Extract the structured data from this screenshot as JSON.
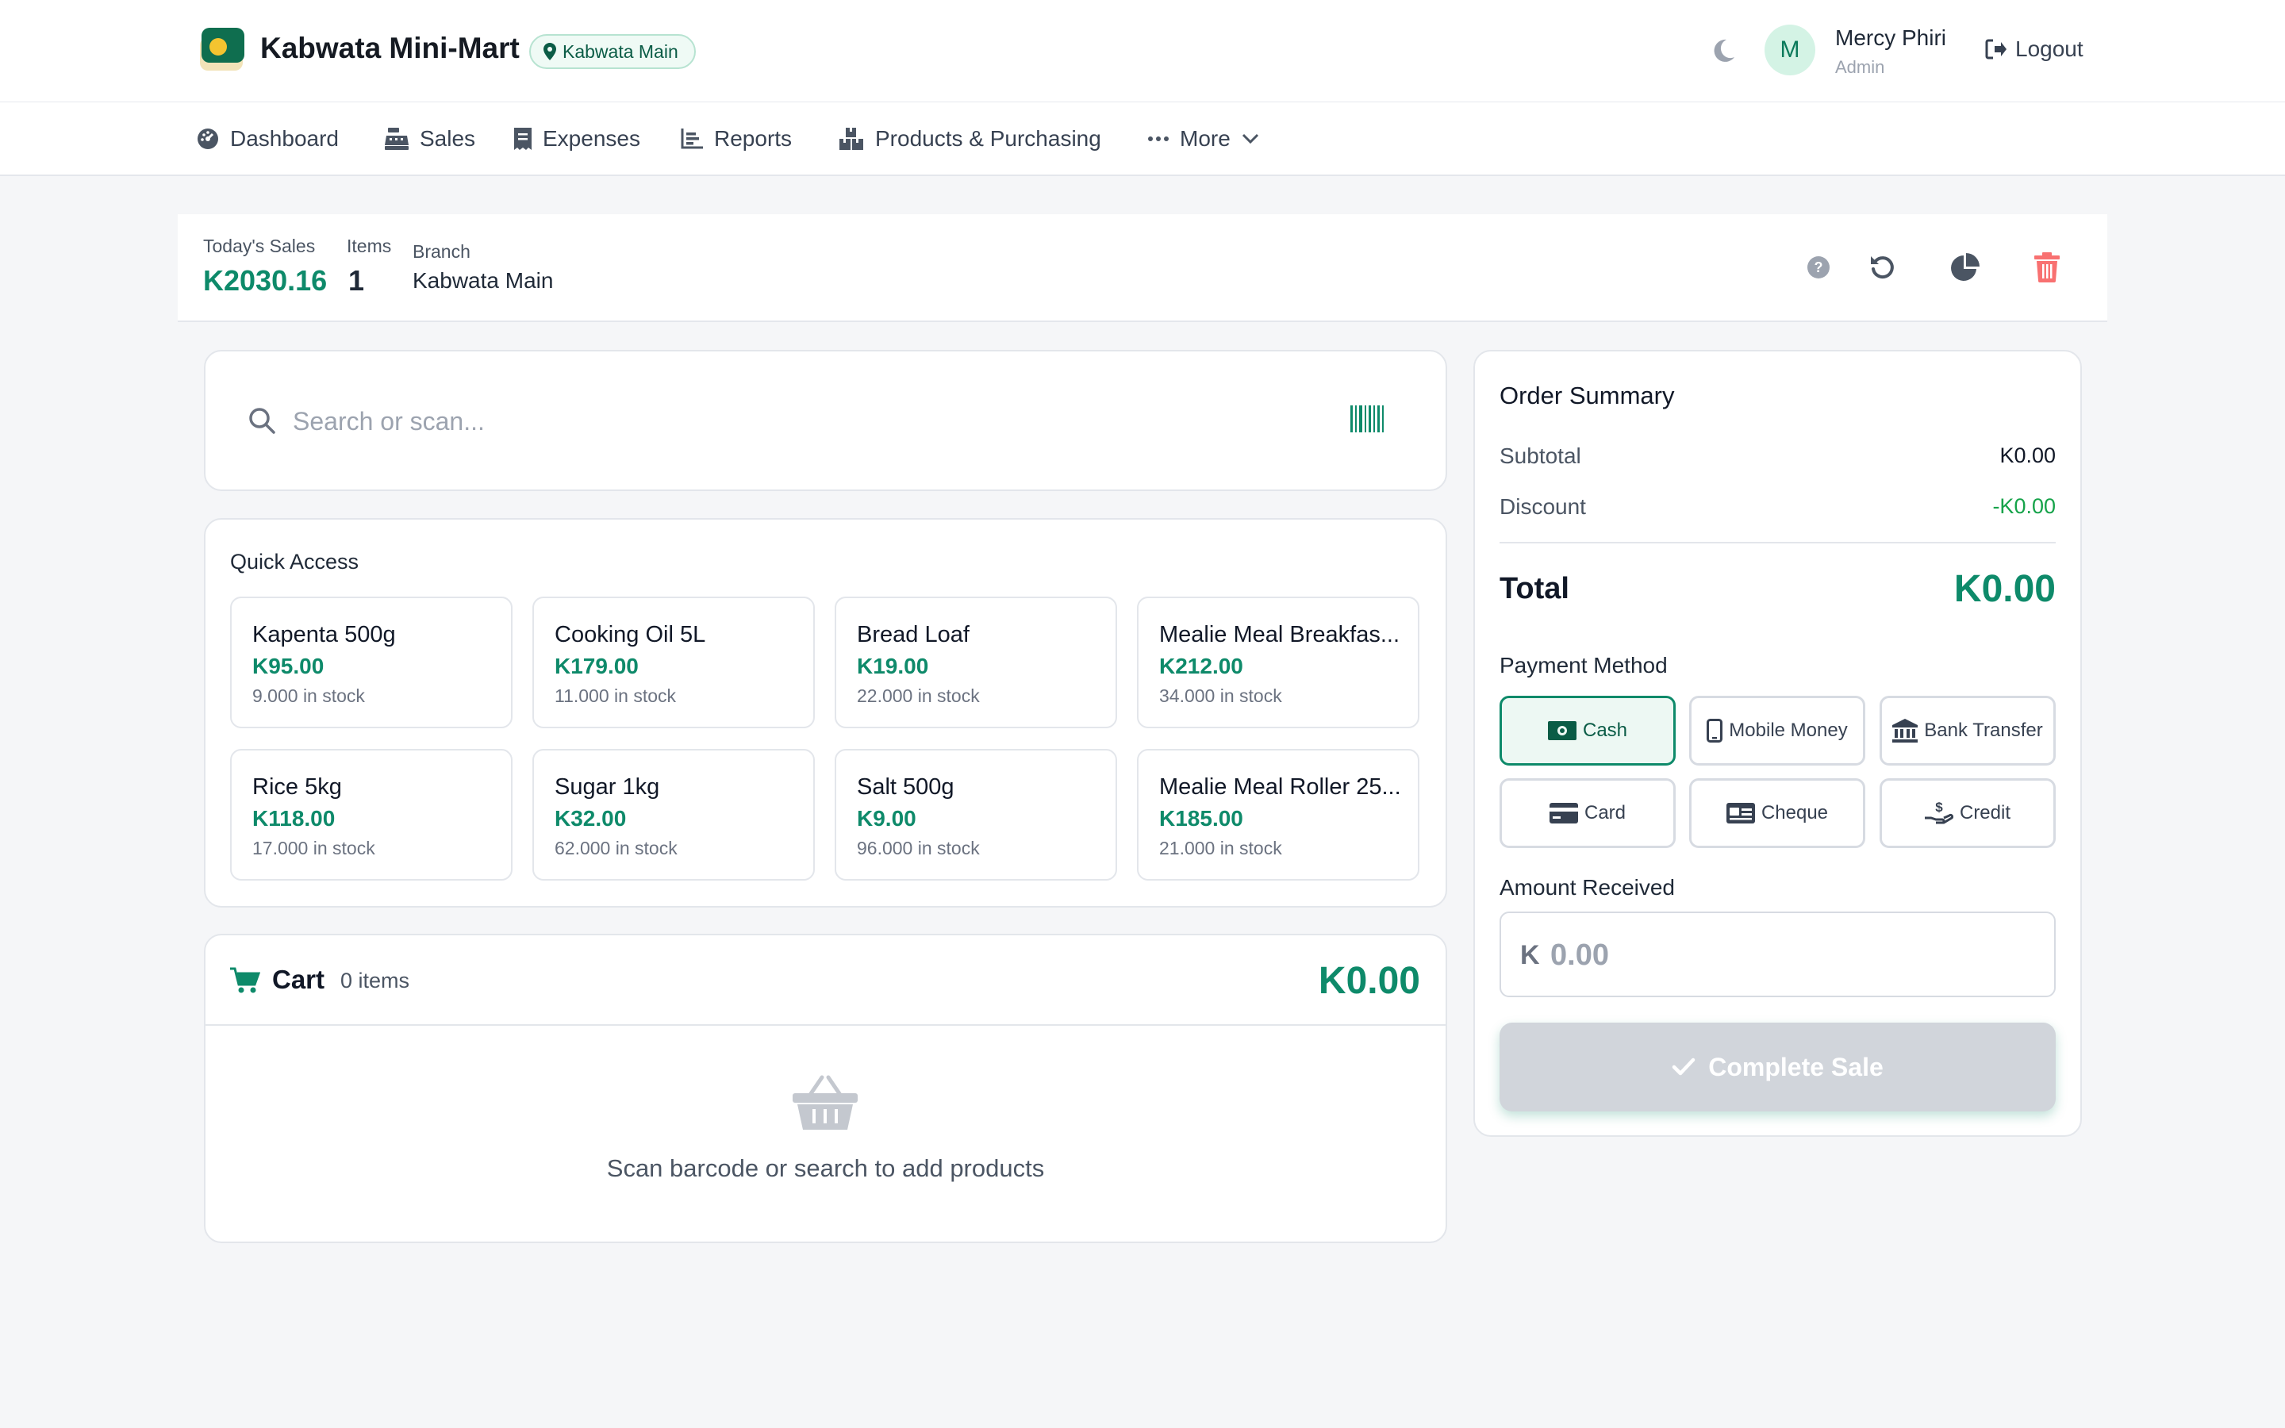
{
  "header": {
    "brand": "Kabwata Mini-Mart",
    "branch_badge": "Kabwata Main",
    "user_initial": "M",
    "user_name": "Mercy Phiri",
    "user_role": "Admin",
    "logout_label": "Logout"
  },
  "nav": {
    "items": [
      {
        "label": "Dashboard",
        "icon": "gauge-icon"
      },
      {
        "label": "Sales",
        "icon": "cash-register-icon"
      },
      {
        "label": "Expenses",
        "icon": "receipt-icon"
      },
      {
        "label": "Reports",
        "icon": "bar-chart-icon"
      },
      {
        "label": "Products & Purchasing",
        "icon": "boxes-icon"
      },
      {
        "label": "More",
        "icon": "ellipsis-icon"
      }
    ]
  },
  "stats": {
    "todays_sales_label": "Today's Sales",
    "todays_sales_value": "K2030.16",
    "items_label": "Items",
    "items_value": "1",
    "branch_label": "Branch",
    "branch_value": "Kabwata Main"
  },
  "search": {
    "placeholder": "Search or scan..."
  },
  "quick_access": {
    "title": "Quick Access",
    "products": [
      {
        "name": "Kapenta 500g",
        "price": "K95.00",
        "stock": "9.000 in stock"
      },
      {
        "name": "Cooking Oil 5L",
        "price": "K179.00",
        "stock": "11.000 in stock"
      },
      {
        "name": "Bread Loaf",
        "price": "K19.00",
        "stock": "22.000 in stock"
      },
      {
        "name": "Mealie Meal Breakfas...",
        "price": "K212.00",
        "stock": "34.000 in stock"
      },
      {
        "name": "Rice 5kg",
        "price": "K118.00",
        "stock": "17.000 in stock"
      },
      {
        "name": "Sugar 1kg",
        "price": "K32.00",
        "stock": "62.000 in stock"
      },
      {
        "name": "Salt 500g",
        "price": "K9.00",
        "stock": "96.000 in stock"
      },
      {
        "name": "Mealie Meal Roller 25...",
        "price": "K185.00",
        "stock": "21.000 in stock"
      }
    ]
  },
  "cart": {
    "title": "Cart",
    "count": "0 items",
    "total": "K0.00",
    "empty_message": "Scan barcode or search to add products"
  },
  "summary": {
    "title": "Order Summary",
    "subtotal_label": "Subtotal",
    "subtotal_value": "K0.00",
    "discount_label": "Discount",
    "discount_value": "-K0.00",
    "total_label": "Total",
    "total_value": "K0.00",
    "payment_method_label": "Payment Method",
    "payment_methods": [
      {
        "label": "Cash",
        "icon": "banknote-icon",
        "active": true
      },
      {
        "label": "Mobile Money",
        "icon": "mobile-phone-icon",
        "active": false
      },
      {
        "label": "Bank Transfer",
        "icon": "bank-icon",
        "active": false
      },
      {
        "label": "Card",
        "icon": "credit-card-icon",
        "active": false
      },
      {
        "label": "Cheque",
        "icon": "cheque-icon",
        "active": false
      },
      {
        "label": "Credit",
        "icon": "hand-dollar-icon",
        "active": false
      }
    ],
    "amount_received_label": "Amount Received",
    "amount_prefix": "K",
    "amount_placeholder": "0.00",
    "complete_label": "Complete Sale"
  },
  "colors": {
    "accent": "#0e8a6a",
    "danger": "#f87171",
    "disabled": "#d1d5db"
  }
}
